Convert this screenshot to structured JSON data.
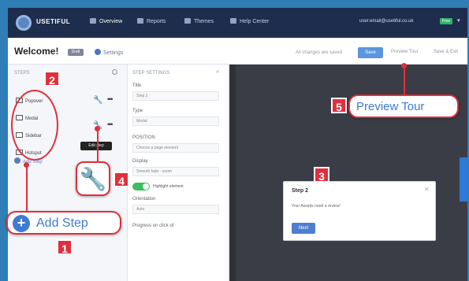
{
  "topnav": {
    "brand": "USETIFUL",
    "items": [
      {
        "label": "Overview"
      },
      {
        "label": "Reports"
      },
      {
        "label": "Themes"
      },
      {
        "label": "Help Center"
      }
    ],
    "user_email": "user.email@usetiful.co.uk",
    "user_badge": "Free"
  },
  "toolbar": {
    "title": "Welcome!",
    "draft_badge": "Draft",
    "settings_label": "Settings",
    "changes_text": "All changes are saved",
    "save_label": "Save",
    "preview_label": "Preview Tour",
    "save_exit_label": "Save & Exit"
  },
  "steps_panel": {
    "header": "STEPS",
    "step_types": [
      {
        "label": "Popover"
      },
      {
        "label": "Modal"
      },
      {
        "label": "Sidebar"
      },
      {
        "label": "Hotspot"
      }
    ],
    "tooltip": "Edit step",
    "add_step_label": "Add Step"
  },
  "settings_panel": {
    "header": "STEP SETTINGS",
    "title_label": "Title",
    "title_value": "Step 2",
    "type_label": "Type",
    "type_value": "Modal",
    "position_label": "POSITION",
    "position_value": "Choose a page element",
    "display_label": "Display",
    "display_value": "Smooth fade - zoom",
    "toggle_label": "Highlight element",
    "orientation_label": "Orientation",
    "orientation_value": "Auto",
    "progress_label": "Progress on click of"
  },
  "canvas": {
    "modal_title": "Step 2",
    "modal_body": "Your Awards need a review!",
    "modal_button": "Next"
  },
  "callouts": {
    "add_step": "Add Step",
    "preview_tour": "Preview Tour",
    "num_1": "1",
    "num_2": "2",
    "num_3": "3",
    "num_4": "4",
    "num_5": "5"
  },
  "colors": {
    "nav_bg": "#1e2c4e",
    "accent_blue": "#3e7bd1",
    "callout_red": "#e12f3c",
    "canvas_bg": "#3a3d46",
    "toggle_green": "#3ebd5b"
  }
}
